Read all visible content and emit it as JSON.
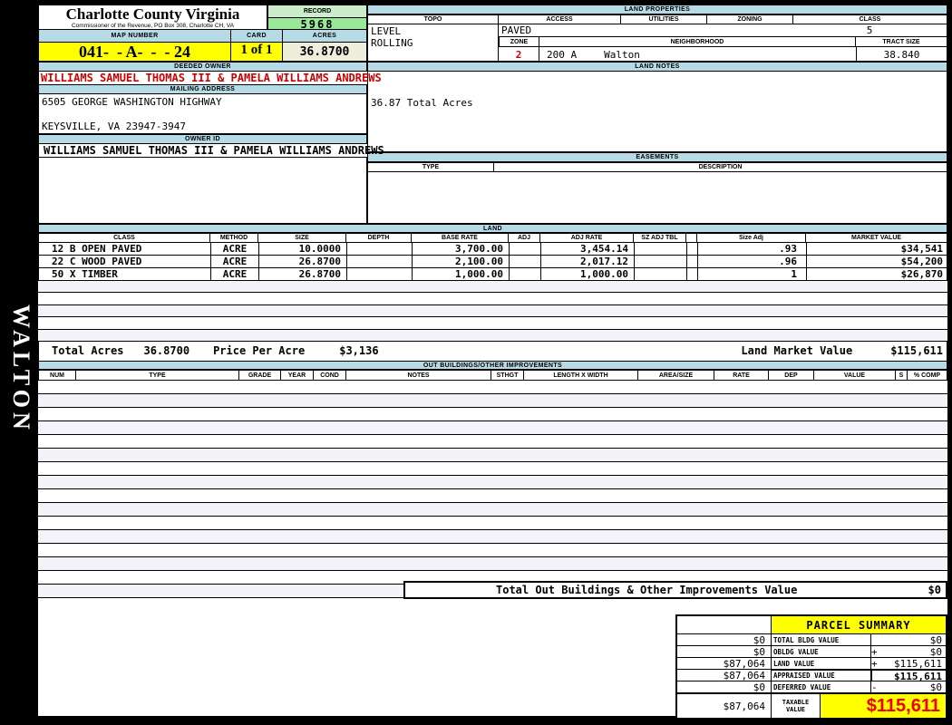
{
  "colors": {
    "band_blue": "#B6DBE7",
    "field_yellow": "#FFFF00",
    "record_green": "#9BE89B",
    "record_green_light": "#CBEDCB",
    "acres_beige": "#EEEEDC",
    "alert_red": "#CC0000",
    "bright_red": "#EE0000",
    "stripe_lavender": "#F3F3F9"
  },
  "sidebar": {
    "district": "WALTON"
  },
  "header": {
    "county_title": "Charlotte County Virginia",
    "county_subtitle": "Commissioner of the Revenue, PO Box 308, Charlotte CH, VA",
    "record_label": "RECORD",
    "record_value": "5968",
    "map_number_label": "MAP NUMBER",
    "map_number_value": "041-  - A-  -  - 24",
    "card_label": "CARD",
    "card_value": "1 of 1",
    "acres_label": "ACRES",
    "acres_value": "36.8700"
  },
  "land_properties": {
    "title": "LAND PROPERTIES",
    "columns": [
      "TOPO",
      "ACCESS",
      "UTILITIES",
      "ZONING",
      "CLASS"
    ],
    "topo_value_1": "LEVEL",
    "topo_value_2": "ROLLING",
    "access_value": "PAVED",
    "class_value": "5",
    "zone_label": "ZONE",
    "zone_value": "2",
    "neighborhood_label": "NEIGHBORHOOD",
    "neighborhood_code": "200 A",
    "neighborhood_name": "Walton",
    "tract_size_label": "TRACT SIZE",
    "tract_size_value": "38.840"
  },
  "owner": {
    "deeded_owner_label": "DEEDED OWNER",
    "deeded_owner": "WILLIAMS SAMUEL THOMAS III & PAMELA WILLIAMS ANDREWS",
    "mailing_address_label": "MAILING ADDRESS",
    "address_line1": "6505 GEORGE WASHINGTON HIGHWAY",
    "address_line2": "KEYSVILLE, VA 23947-3947",
    "owner_id_label": "OWNER ID",
    "owner_id": "WILLIAMS SAMUEL THOMAS III & PAMELA WILLIAMS ANDREWS"
  },
  "land_notes": {
    "title": "LAND NOTES",
    "note": "36.87 Total Acres"
  },
  "easements": {
    "title": "EASEMENTS",
    "type_label": "TYPE",
    "description_label": "DESCRIPTION"
  },
  "land": {
    "title": "LAND",
    "columns": [
      "CLASS",
      "METHOD",
      "SIZE",
      "DEPTH",
      "BASE RATE",
      "ADJ",
      "ADJ RATE",
      "SZ ADJ TBL",
      "Size Adj",
      "MARKET VALUE"
    ],
    "rows": [
      {
        "class": "12 B OPEN PAVED",
        "method": "ACRE",
        "size": "10.0000",
        "depth": "",
        "base_rate": "3,700.00",
        "adj": "",
        "adj_rate": "3,454.14",
        "sz_adj_tbl": "",
        "size_adj": ".93",
        "market_value": "$34,541"
      },
      {
        "class": "22 C WOOD PAVED",
        "method": "ACRE",
        "size": "26.8700",
        "depth": "",
        "base_rate": "2,100.00",
        "adj": "",
        "adj_rate": "2,017.12",
        "sz_adj_tbl": "",
        "size_adj": ".96",
        "market_value": "$54,200"
      },
      {
        "class": "50 X TIMBER",
        "method": "ACRE",
        "size": "26.8700",
        "depth": "",
        "base_rate": "1,000.00",
        "adj": "",
        "adj_rate": "1,000.00",
        "sz_adj_tbl": "",
        "size_adj": "1",
        "market_value": "$26,870"
      }
    ],
    "totals": {
      "total_acres_label": "Total Acres",
      "total_acres": "36.8700",
      "price_per_acre_label": "Price Per Acre",
      "price_per_acre": "$3,136",
      "land_market_value_label": "Land Market Value",
      "land_market_value": "$115,611"
    }
  },
  "out_buildings": {
    "title": "OUT BUILDINGS/OTHER IMPROVEMENTS",
    "columns": [
      "NUM",
      "TYPE",
      "GRADE",
      "YEAR",
      "COND",
      "NOTES",
      "STHGT",
      "LENGTH X WIDTH",
      "AREA/SIZE",
      "RATE",
      "DEP",
      "VALUE",
      "S",
      "% COMP"
    ],
    "total_label": "Total Out Buildings & Other Improvements Value",
    "total_value": "$0"
  },
  "parcel_summary": {
    "title": "PARCEL SUMMARY",
    "rows": [
      {
        "prior": "$0",
        "label": "TOTAL BLDG VALUE",
        "op": "",
        "value": "$0"
      },
      {
        "prior": "$0",
        "label": "OBLDG VALUE",
        "op": "+",
        "value": "$0"
      },
      {
        "prior": "$87,064",
        "label": "LAND VALUE",
        "op": "+",
        "value": "$115,611"
      },
      {
        "prior": "$87,064",
        "label": "APPRAISED VALUE",
        "op": "",
        "value": "$115,611"
      },
      {
        "prior": "$0",
        "label": "DEFERRED VALUE",
        "op": "-",
        "value": "$0"
      }
    ],
    "taxable": {
      "prior": "$87,064",
      "label": "TAXABLE VALUE",
      "value": "$115,611"
    }
  }
}
